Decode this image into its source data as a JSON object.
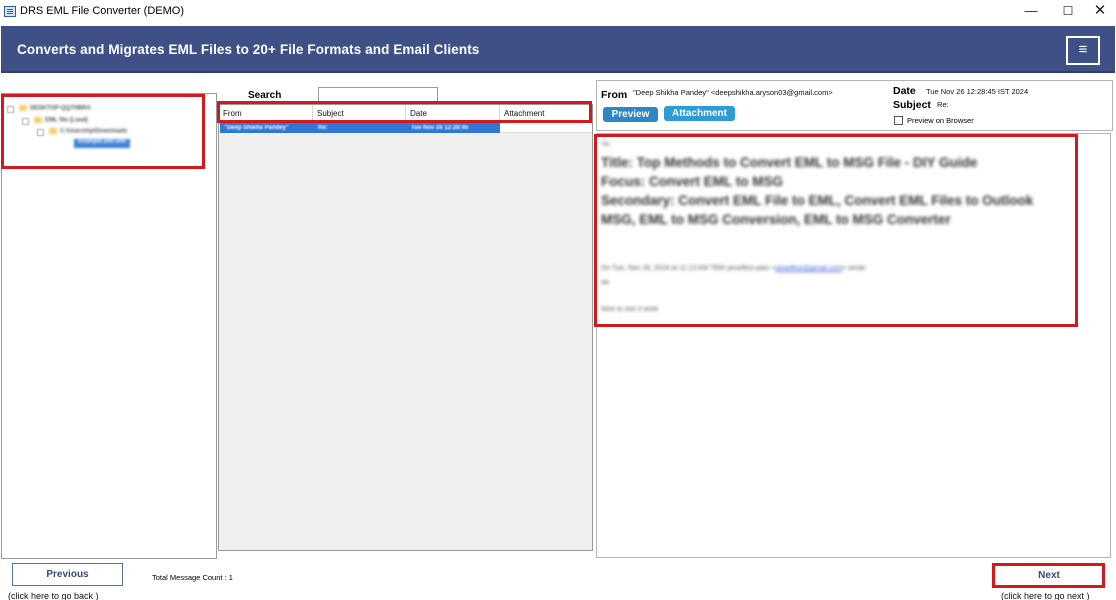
{
  "window": {
    "title": "DRS EML File Converter (DEMO)",
    "minimize": "—",
    "maximize": "☐",
    "close": "✕"
  },
  "banner": {
    "headline": "Converts and Migrates EML Files to 20+ File Formats and Email Clients",
    "menu_icon": "≡"
  },
  "tree": {
    "nodes": [
      {
        "label": "DESKTOP-QQ7HBRA",
        "depth": 0
      },
      {
        "label": "EML file (Load)",
        "depth": 1
      },
      {
        "label": "C:\\Users\\hp\\Downloads",
        "depth": 2
      },
      {
        "label": "example.eml.eml",
        "depth": 3,
        "selected": true
      }
    ]
  },
  "search": {
    "label": "Search",
    "value": ""
  },
  "grid": {
    "columns": [
      "From",
      "Subject",
      "Date",
      "Attachment"
    ],
    "rows": [
      {
        "from": "\"Deep Shikha Pandey\"",
        "subject": "Re:",
        "date": "Tue Nov 26 12:28:45",
        "attachment": ""
      }
    ]
  },
  "preview_header": {
    "from_label": "From",
    "from_value": "\"Deep Shikha Pandey\" <deepshikha.aryson03@gmail.com>",
    "date_label": "Date",
    "date_value": "Tue Nov 26 12:28:45 IST 2024",
    "subject_label": "Subject",
    "subject_value": "Re:",
    "preview_btn": "Preview",
    "attachment_btn": "Attachment",
    "preview_browser_label": "Preview on Browser"
  },
  "preview_body": {
    "greeting": "Hi,",
    "line1": "Title: Top Methods to Convert EML to MSG File - DIY Guide",
    "line2": "Focus: Convert EML to MSG",
    "line3": "Secondary: Convert EML File to EML, Convert EML Files to Outlook",
    "line4": "MSG, EML to MSG Conversion, EML to MSG Converter",
    "quote_prefix": "On Tue, Nov 26, 2024 at 11:13 AM TEM yeseffice.plan <",
    "quote_link": "yeseffice@gmail.com",
    "quote_suffix": "> wrote:",
    "quote_line2": "aa",
    "signature": "Nice to see it work"
  },
  "footer": {
    "previous_btn": "Previous",
    "previous_hint": "(click here to  go back )",
    "total_count": "Total Message Count : 1",
    "next_btn": "Next",
    "next_hint": "(click here to  go next )"
  },
  "colors": {
    "banner": "#3e5085",
    "highlight": "#d2191f",
    "selection": "#2f78d6",
    "preview_btn": "#2f86c5",
    "attachment_btn": "#2d9cd6"
  }
}
